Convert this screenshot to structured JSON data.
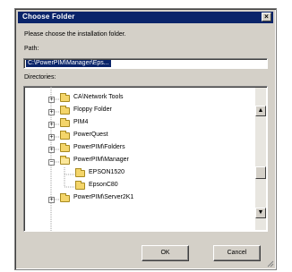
{
  "window": {
    "title": "Choose Folder",
    "close_glyph": "×"
  },
  "instruction": "Please choose the installation folder.",
  "path": {
    "label": "Path:",
    "value": "C:\\PowerPIM\\Manager\\Eps..."
  },
  "directories": {
    "label": "Directories:",
    "items": [
      {
        "label": "CA\\Network Tools",
        "expanded": false
      },
      {
        "label": "Floppy Folder",
        "expanded": false
      },
      {
        "label": "PIM4",
        "expanded": false
      },
      {
        "label": "PowerQuest",
        "expanded": false
      },
      {
        "label": "PowerPIM\\Folders",
        "expanded": false
      },
      {
        "label": "PowerPIM\\Manager",
        "expanded": true
      },
      {
        "label": "EPSON1520",
        "child": true
      },
      {
        "label": "EpsonC80",
        "child": true
      },
      {
        "label": "PowerPIM\\Server2K1",
        "expanded": false
      }
    ]
  },
  "scrollbar": {
    "up_glyph": "▲",
    "down_glyph": "▼"
  },
  "buttons": {
    "ok": "OK",
    "cancel": "Cancel"
  },
  "icons": {
    "folder": "folder-icon",
    "open_folder": "open-folder-icon",
    "close": "close-icon"
  }
}
